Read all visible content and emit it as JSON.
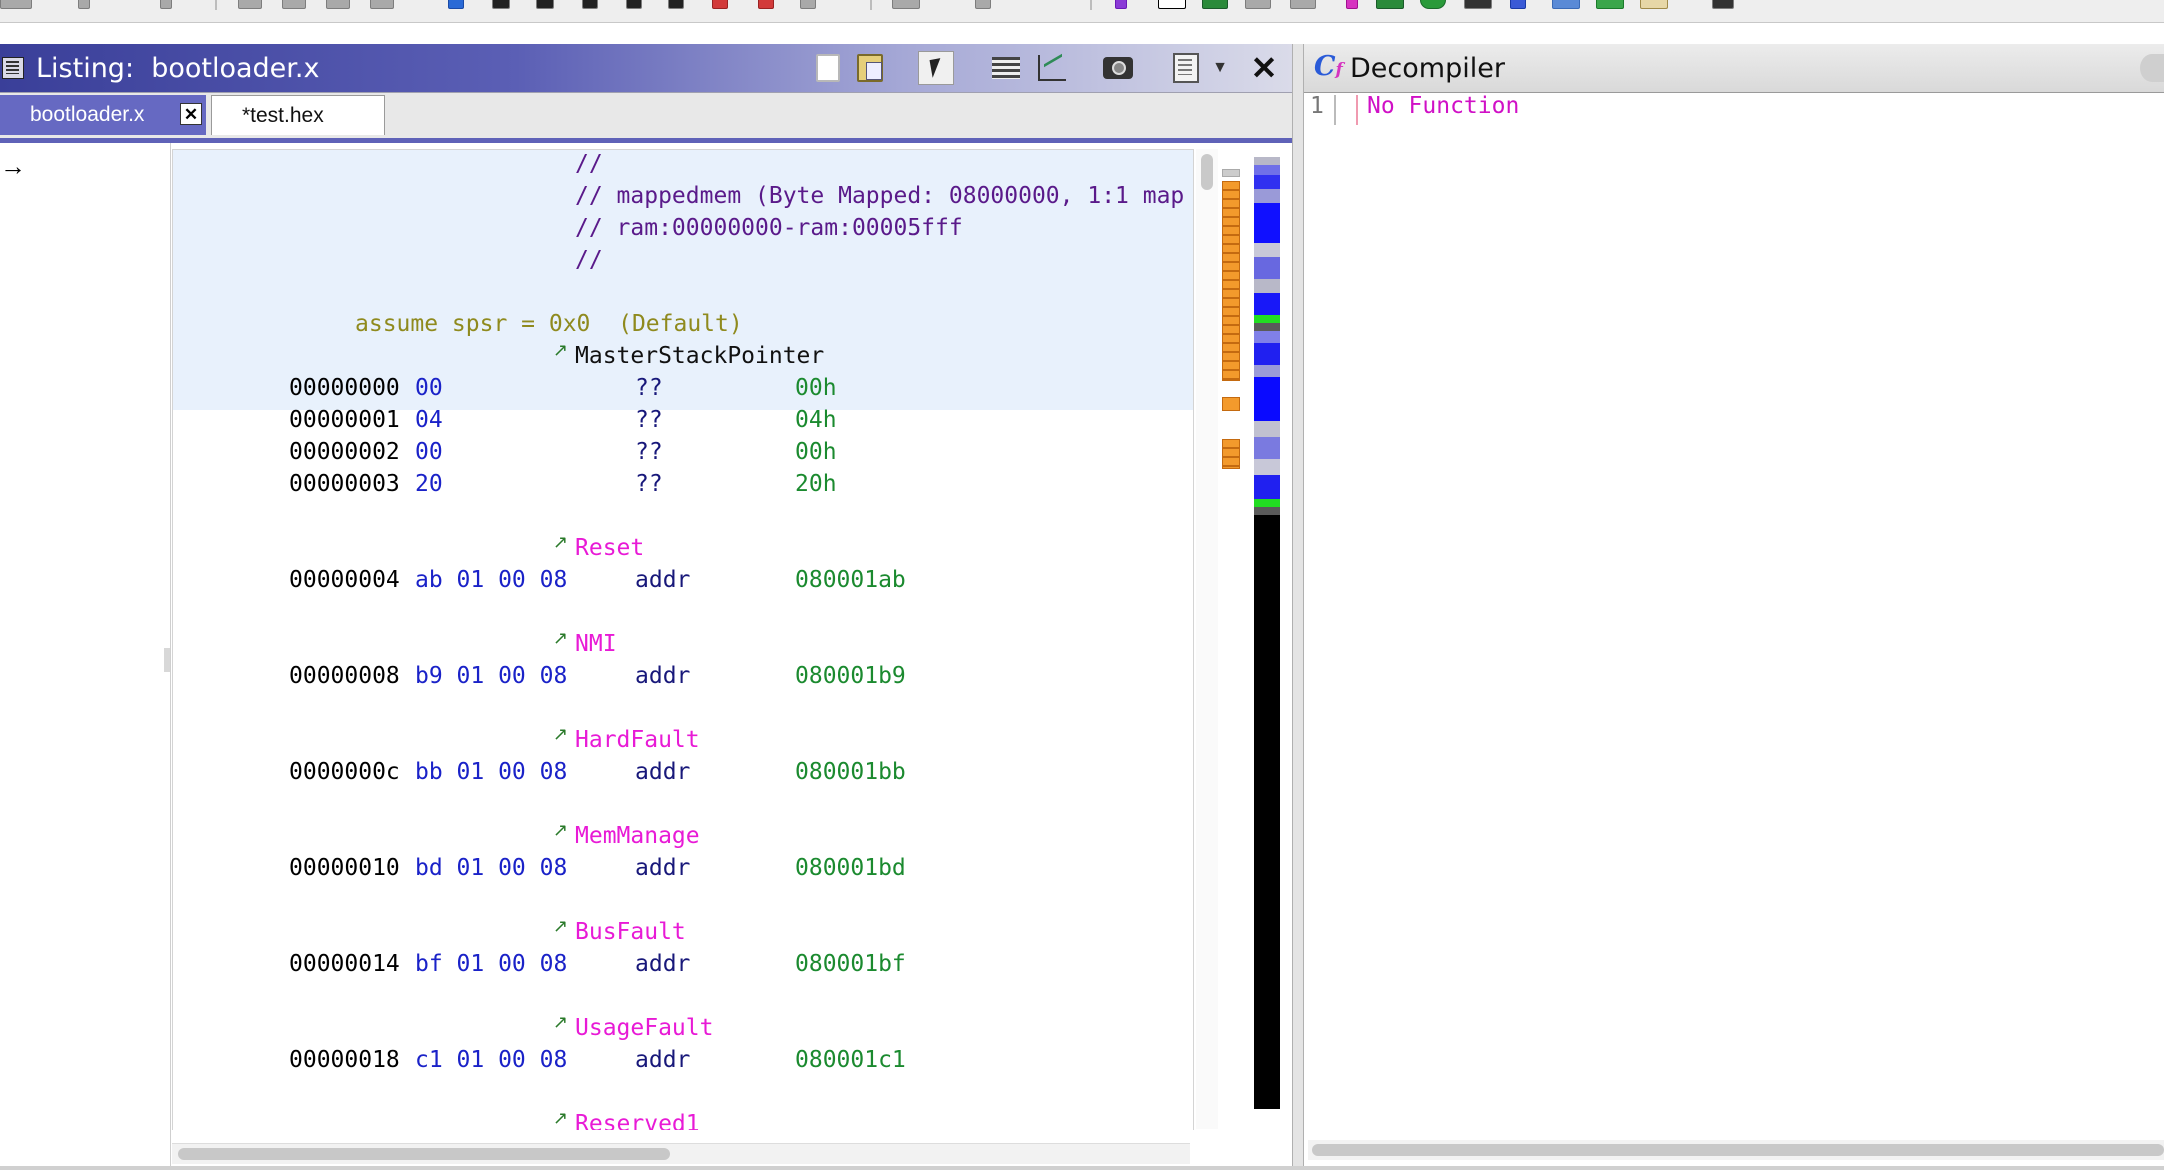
{
  "listing": {
    "title": "Listing:  bootloader.x",
    "tabs": [
      {
        "label": "bootloader.x",
        "active": true
      },
      {
        "label": "*test.hex",
        "active": false
      }
    ],
    "tab_close_glyph": "✕",
    "header_comments": [
      "//",
      "// mappedmem (Byte Mapped: 08000000, 1:1 map",
      "// ram:00000000-ram:00005fff",
      "//"
    ],
    "assume": "assume spsr = 0x0  (Default)",
    "master_label": "MasterStackPointer",
    "msp_rows": [
      {
        "addr": "00000000",
        "bytes": "00",
        "mnemonic": "??",
        "operand": "00h"
      },
      {
        "addr": "00000001",
        "bytes": "04",
        "mnemonic": "??",
        "operand": "04h"
      },
      {
        "addr": "00000002",
        "bytes": "00",
        "mnemonic": "??",
        "operand": "00h"
      },
      {
        "addr": "00000003",
        "bytes": "20",
        "mnemonic": "??",
        "operand": "20h"
      }
    ],
    "vectors": [
      {
        "label": "Reset",
        "addr": "00000004",
        "bytes": "ab 01 00 08",
        "mnemonic": "addr",
        "operand": "080001ab"
      },
      {
        "label": "NMI",
        "addr": "00000008",
        "bytes": "b9 01 00 08",
        "mnemonic": "addr",
        "operand": "080001b9"
      },
      {
        "label": "HardFault",
        "addr": "0000000c",
        "bytes": "bb 01 00 08",
        "mnemonic": "addr",
        "operand": "080001bb"
      },
      {
        "label": "MemManage",
        "addr": "00000010",
        "bytes": "bd 01 00 08",
        "mnemonic": "addr",
        "operand": "080001bd"
      },
      {
        "label": "BusFault",
        "addr": "00000014",
        "bytes": "bf 01 00 08",
        "mnemonic": "addr",
        "operand": "080001bf"
      },
      {
        "label": "UsageFault",
        "addr": "00000018",
        "bytes": "c1 01 00 08",
        "mnemonic": "addr",
        "operand": "080001c1"
      }
    ],
    "partial_label": "Reserved1",
    "ref_arrow_glyph": "↗",
    "margin_arrow_glyph": "→",
    "close_glyph": "✕",
    "toolbar_icons": [
      "copy-icon",
      "paste-icon",
      "cursor-icon",
      "field-layout-icon",
      "diff-icon",
      "snapshot-icon",
      "window-menu-icon",
      "close-icon"
    ]
  },
  "decompiler": {
    "title": "Decompiler",
    "icon_letters": {
      "c": "C",
      "f": "f"
    },
    "line_number": "1",
    "text": "No Function"
  },
  "colors": {
    "title_active": "#3a3f99",
    "tab_active": "#6669c2",
    "label_func": "#e81ad6",
    "bytes": "#1a22c8",
    "operand": "#1b8a2f",
    "comment": "#5a1a8a",
    "assume": "#8f8a1e",
    "marker_orange": "#f39a2c"
  }
}
